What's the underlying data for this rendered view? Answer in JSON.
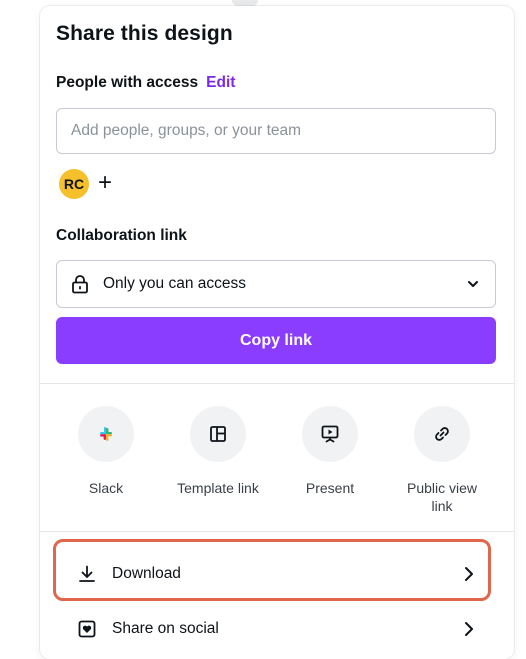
{
  "dialog": {
    "title": "Share this design"
  },
  "people": {
    "label": "People with access",
    "edit_label": "Edit",
    "input_placeholder": "Add people, groups, or your team",
    "input_value": "",
    "avatar_initials": "RC",
    "add_icon_text": "+"
  },
  "collaboration": {
    "label": "Collaboration link",
    "access_value": "Only you can access",
    "copy_label": "Copy link"
  },
  "share_options": [
    {
      "label": "Slack",
      "icon": "slack-icon"
    },
    {
      "label": "Template link",
      "icon": "template-icon"
    },
    {
      "label": "Present",
      "icon": "present-icon"
    },
    {
      "label": "Public view link",
      "icon": "link-icon"
    }
  ],
  "rows": [
    {
      "label": "Download",
      "icon": "download-icon",
      "highlighted": true
    },
    {
      "label": "Share on social",
      "icon": "heart-icon",
      "highlighted": false
    }
  ],
  "colors": {
    "accent": "#8b3dff",
    "edit_link": "#7d2ae8",
    "avatar": "#f5c02b",
    "highlight_border": "#e0674c"
  }
}
